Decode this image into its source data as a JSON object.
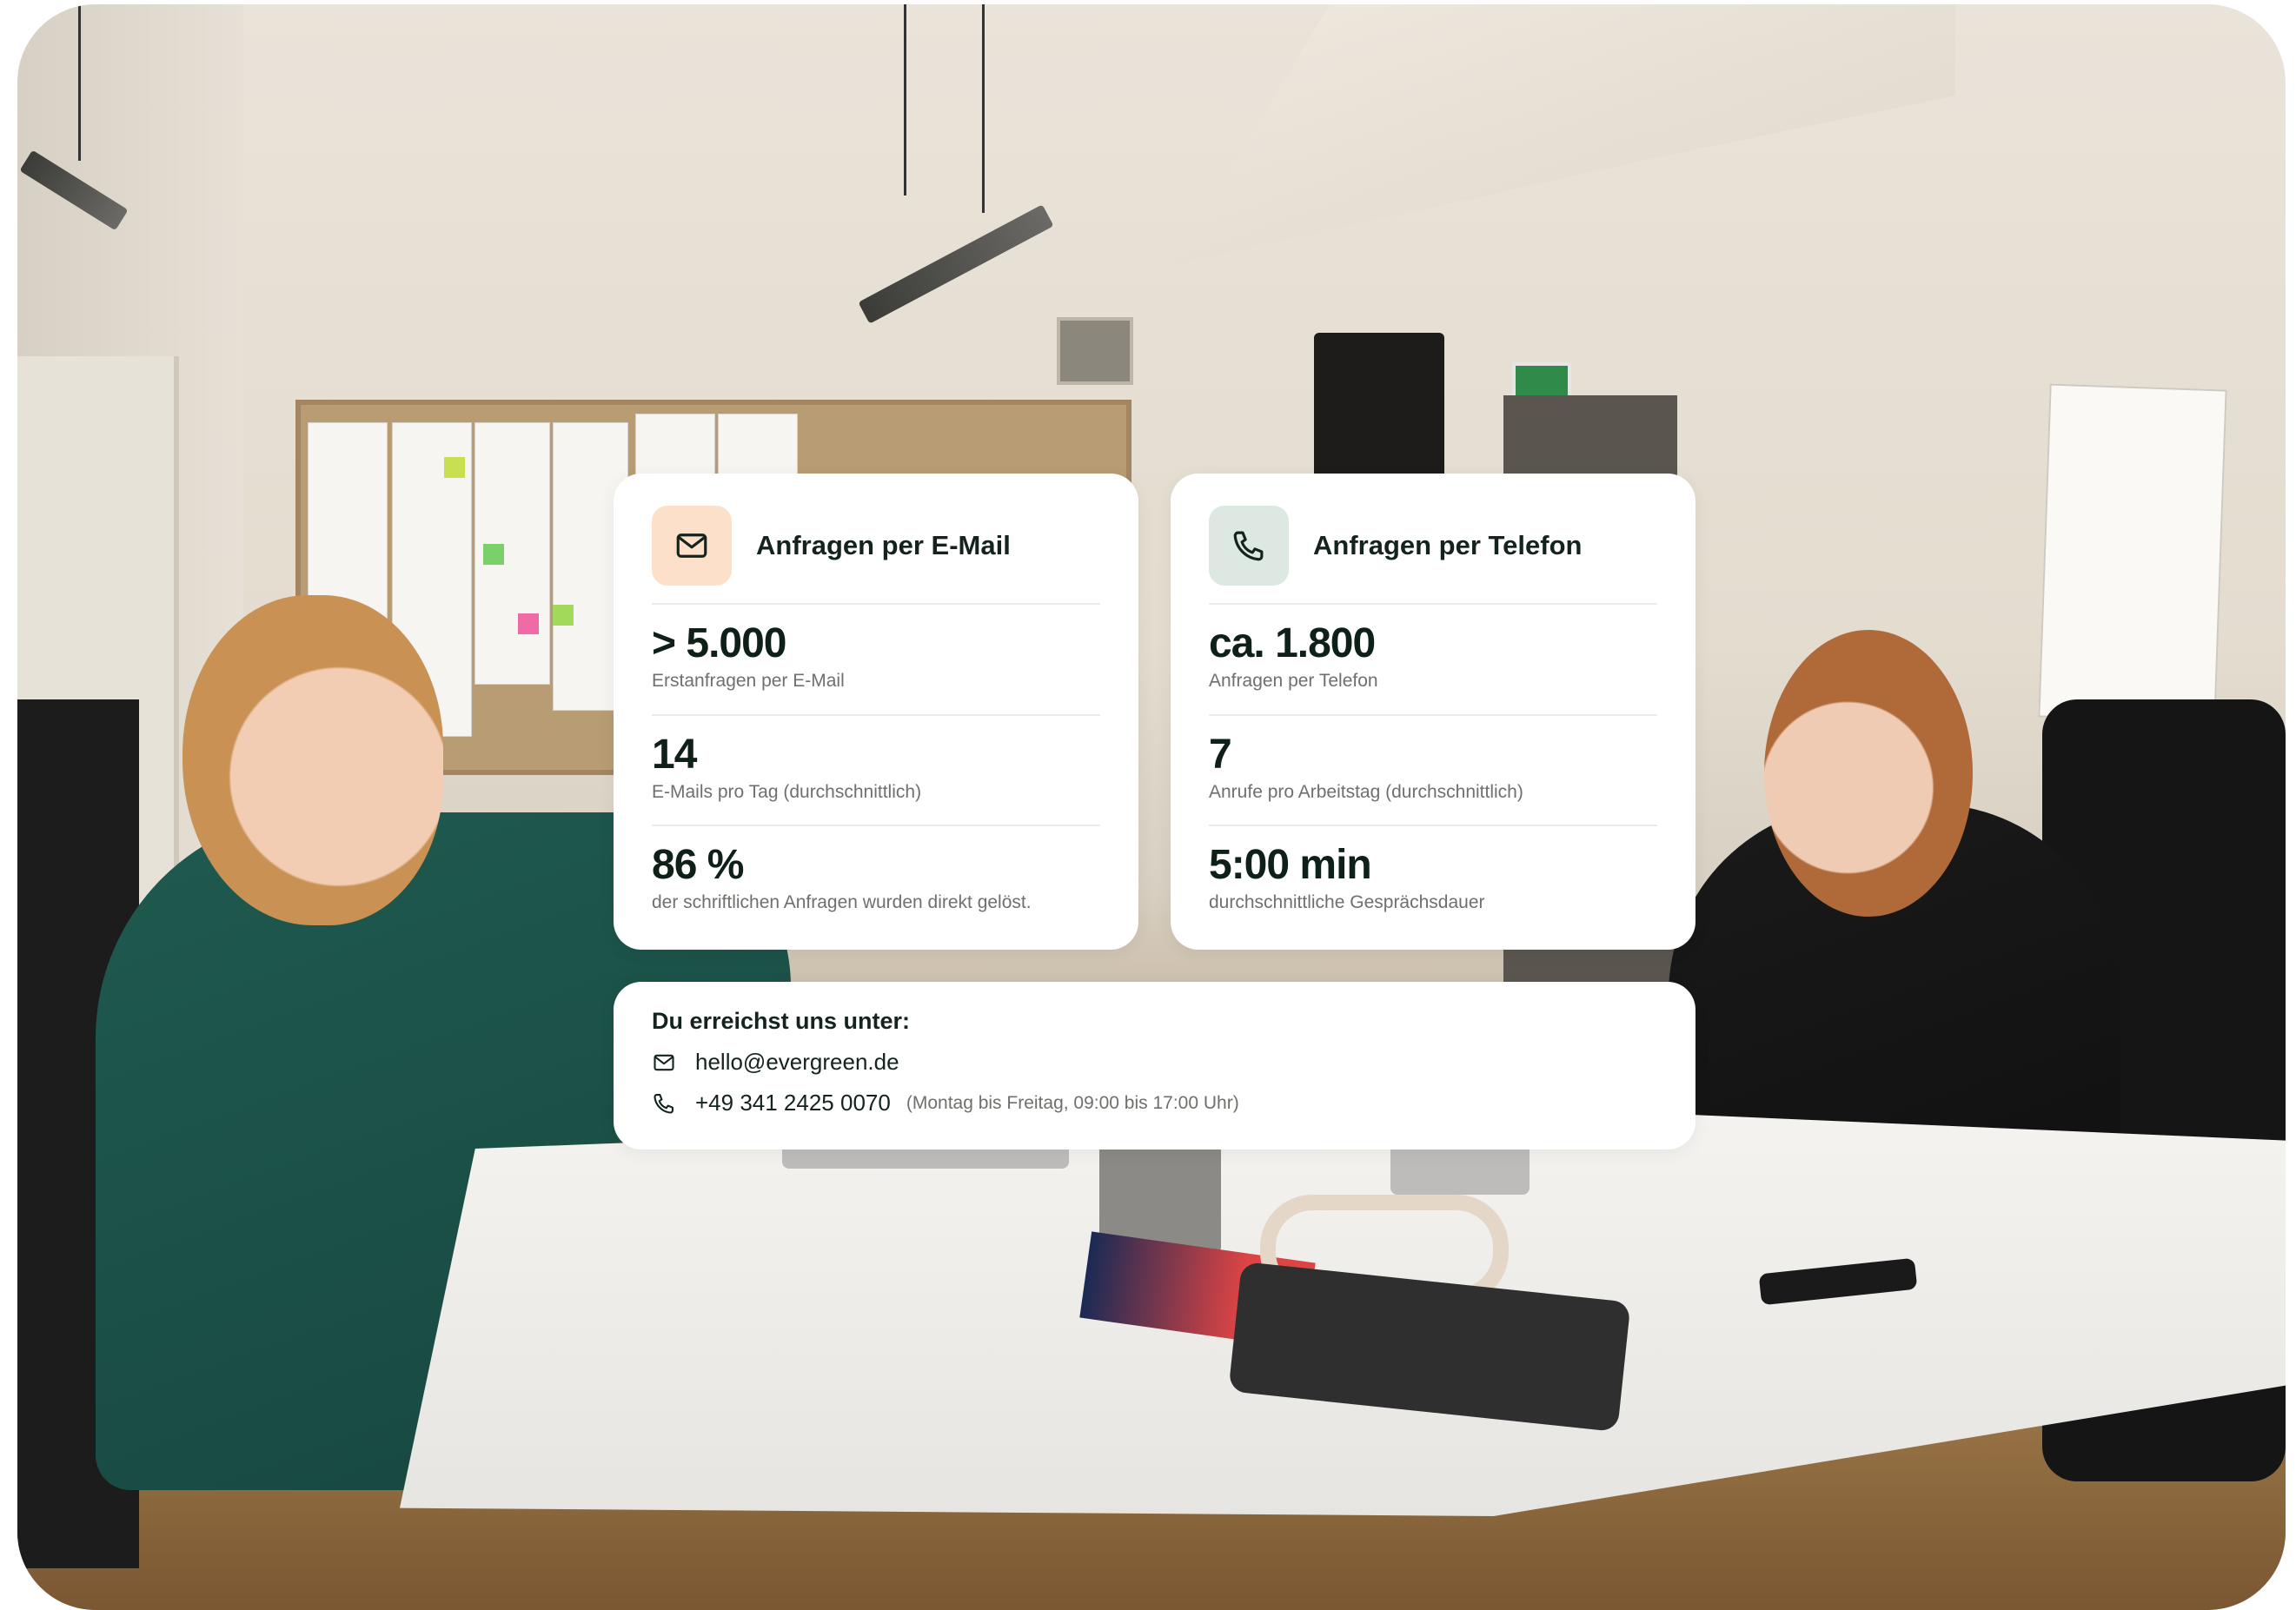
{
  "colors": {
    "email_icon_bg": "#fde0c9",
    "phone_icon_bg": "#dde8e2",
    "icon_stroke": "#14231d",
    "text_dark": "#0f2018",
    "text_muted": "#6f6f6b"
  },
  "email_card": {
    "icon": "mail-icon",
    "title": "Anfragen per E-Mail",
    "stats": [
      {
        "value": "> 5.000",
        "label": "Erstanfragen per E-Mail"
      },
      {
        "value": "14",
        "label": "E-Mails pro Tag (durchschnittlich)"
      },
      {
        "value": "86 %",
        "label": "der schriftlichen Anfragen wurden direkt gelöst."
      }
    ]
  },
  "phone_card": {
    "icon": "phone-icon",
    "title": "Anfragen per Telefon",
    "stats": [
      {
        "value": "ca. 1.800",
        "label": "Anfragen per Telefon"
      },
      {
        "value": "7",
        "label": "Anrufe pro Arbeitstag (durchschnittlich)"
      },
      {
        "value": "5:00 min",
        "label": "durchschnittliche Gesprächsdauer"
      }
    ]
  },
  "contact": {
    "title": "Du erreichst uns unter:",
    "email": "hello@evergreen.de",
    "phone": "+49 341 2425 0070",
    "hours": "(Montag bis Freitag, 09:00 bis 17:00 Uhr)"
  }
}
